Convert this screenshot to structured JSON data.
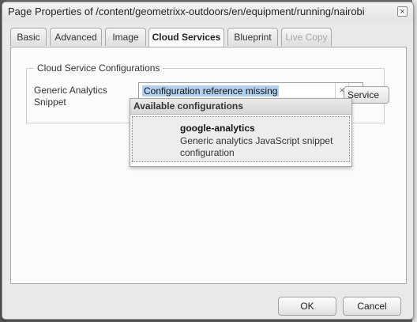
{
  "dialog": {
    "title": "Page Properties of /content/geometrixx-outdoors/en/equipment/running/nairobi",
    "close_glyph": "×"
  },
  "tabs": [
    {
      "label": "Basic"
    },
    {
      "label": "Advanced"
    },
    {
      "label": "Image"
    },
    {
      "label": "Cloud Services"
    },
    {
      "label": "Blueprint"
    },
    {
      "label": "Live Copy"
    }
  ],
  "active_tab": "Cloud Services",
  "cloud_services": {
    "legend": "Cloud Service Configurations",
    "field_label": "Generic Analytics Snippet",
    "combo_value": "Configuration reference missing",
    "clear_glyph": "×",
    "arrow_glyph": "▾",
    "add_button_label": "Service"
  },
  "dropdown": {
    "header": "Available configurations",
    "items": [
      {
        "name": "google-analytics",
        "description": "Generic analytics JavaScript snippet configuration"
      }
    ]
  },
  "footer": {
    "ok_label": "OK",
    "cancel_label": "Cancel"
  },
  "colors": {
    "selection_highlight": "#b3cfee",
    "dialog_bg": "#e9e9e9"
  }
}
